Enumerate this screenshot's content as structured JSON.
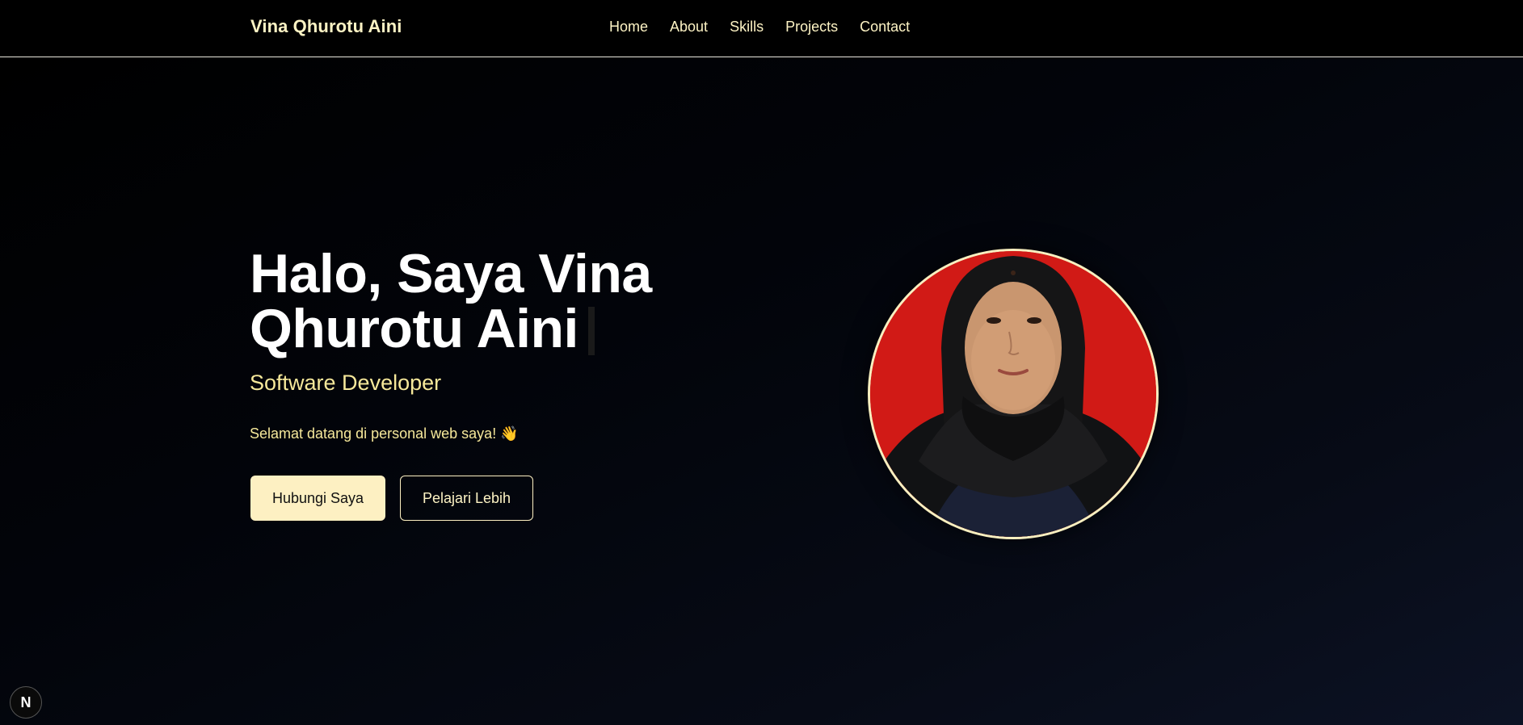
{
  "nav": {
    "brand": "Vina Qhurotu Aini",
    "links": [
      "Home",
      "About",
      "Skills",
      "Projects",
      "Contact"
    ]
  },
  "hero": {
    "title_line1": "Halo, Saya Vina",
    "title_line2": "Qhurotu Aini",
    "subtitle": "Software Developer",
    "welcome": "Selamat datang di personal web saya! 👋",
    "primary_button": "Hubungi Saya",
    "secondary_button": "Pelajari Lebih"
  },
  "dev_badge": {
    "label": "N",
    "icon": "nextjs-icon"
  },
  "colors": {
    "accent": "#fdf0c2",
    "subtitle": "#f6e89a",
    "photo_background": "#d11a16"
  }
}
